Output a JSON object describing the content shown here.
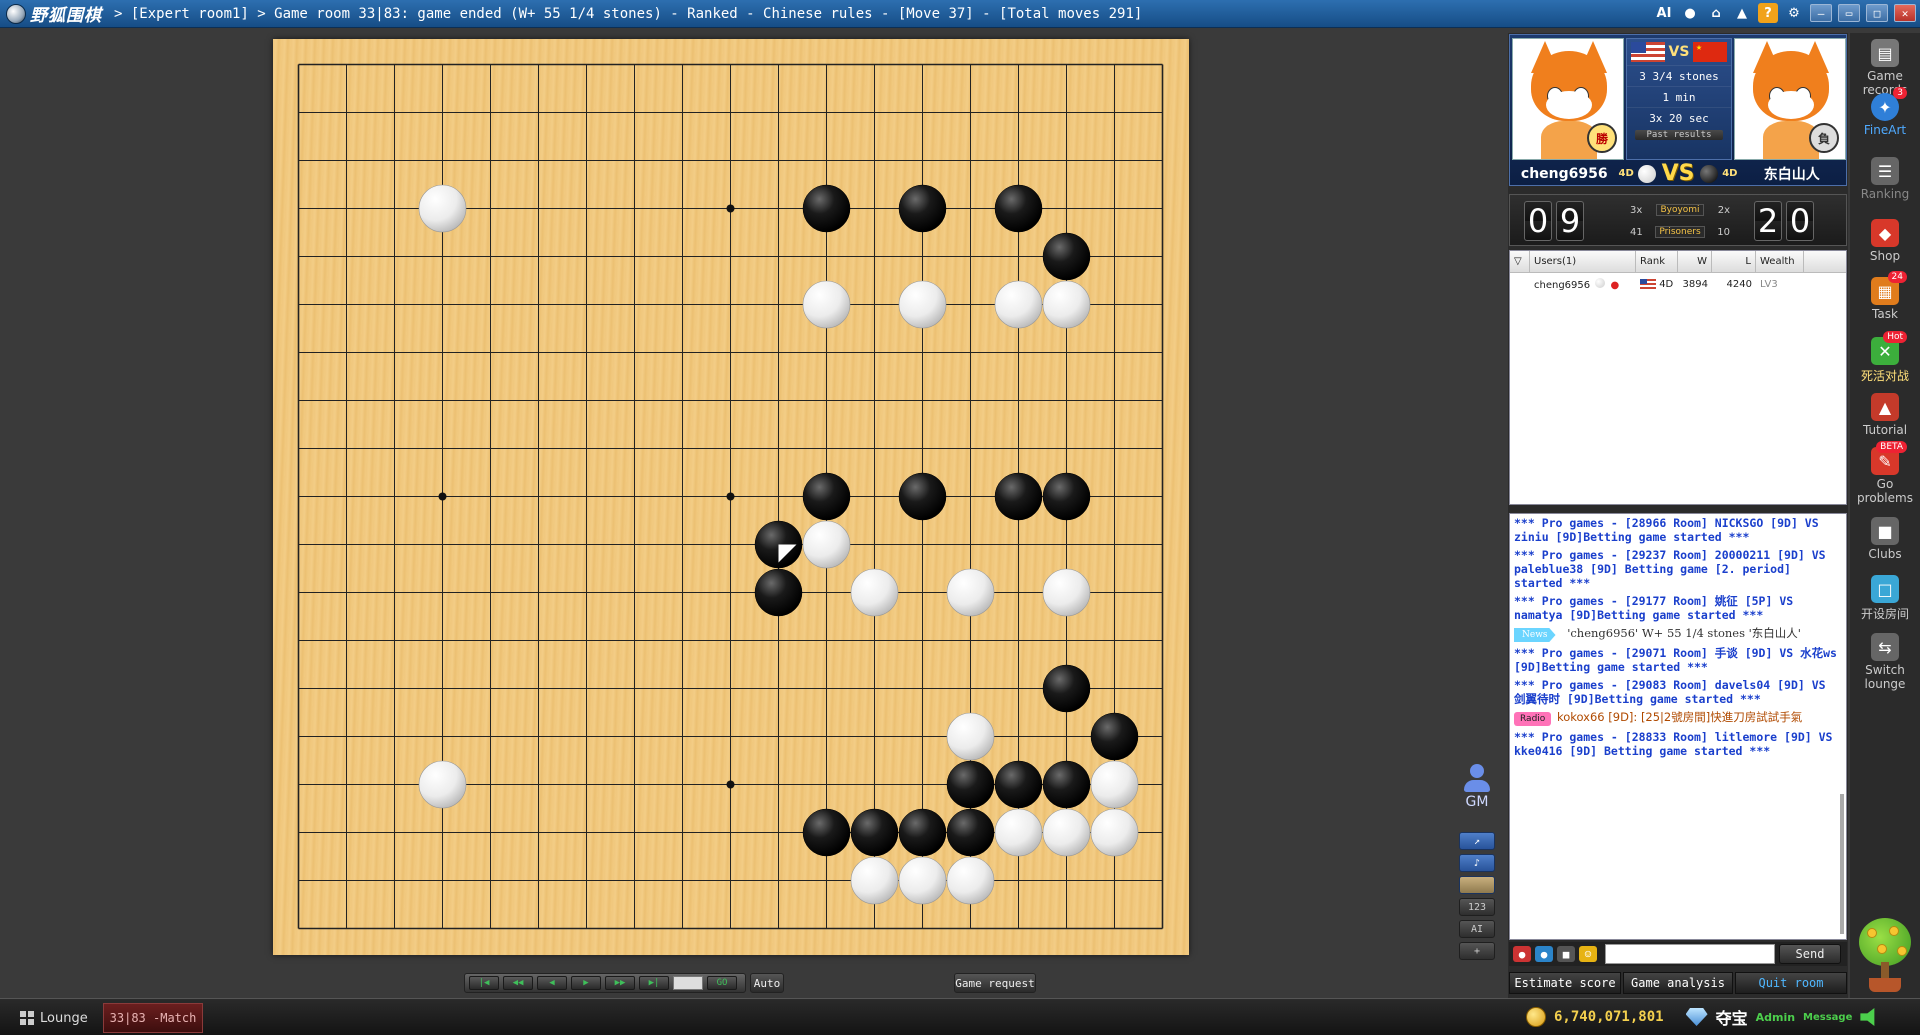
{
  "titlebar": {
    "app_name": "野狐围棋",
    "title": "> [Expert room1] > Game room 33|83: game ended (W+ 55 1/4 stones) - Ranked - Chinese rules - [Move 37] - [Total moves 291]",
    "icons": [
      "ai-icon",
      "user-icon",
      "home-icon",
      "shirt-icon",
      "help-icon",
      "settings-icon"
    ],
    "ai_label": "AI",
    "help_label": "?",
    "window_buttons": [
      "minimize",
      "restore",
      "maximize",
      "close"
    ]
  },
  "board": {
    "size": 19,
    "hoshi": [
      [
        3,
        3
      ],
      [
        3,
        9
      ],
      [
        3,
        15
      ],
      [
        9,
        3
      ],
      [
        9,
        9
      ],
      [
        9,
        15
      ],
      [
        15,
        3
      ],
      [
        15,
        9
      ],
      [
        15,
        15
      ]
    ],
    "black_stones": [
      [
        3,
        11
      ],
      [
        3,
        13
      ],
      [
        3,
        15
      ],
      [
        4,
        16
      ],
      [
        9,
        11
      ],
      [
        9,
        13
      ],
      [
        9,
        15
      ],
      [
        9,
        16
      ],
      [
        10,
        10
      ],
      [
        11,
        10
      ],
      [
        13,
        16
      ],
      [
        14,
        17
      ],
      [
        15,
        14
      ],
      [
        15,
        15
      ],
      [
        15,
        16
      ],
      [
        16,
        11
      ],
      [
        16,
        12
      ],
      [
        16,
        13
      ],
      [
        16,
        14
      ]
    ],
    "white_stones": [
      [
        3,
        3
      ],
      [
        5,
        11
      ],
      [
        5,
        13
      ],
      [
        5,
        15
      ],
      [
        5,
        16
      ],
      [
        10,
        11
      ],
      [
        11,
        12
      ],
      [
        11,
        14
      ],
      [
        11,
        16
      ],
      [
        14,
        14
      ],
      [
        15,
        3
      ],
      [
        15,
        17
      ],
      [
        16,
        15
      ],
      [
        16,
        16
      ],
      [
        16,
        17
      ],
      [
        17,
        12
      ],
      [
        17,
        13
      ],
      [
        17,
        14
      ]
    ],
    "last_move": [
      10,
      10
    ]
  },
  "controls": {
    "buttons": [
      "|◀",
      "◀◀",
      "◀",
      "▶",
      "▶▶",
      "▶|",
      "GO"
    ],
    "auto_label": "Auto",
    "game_request_label": "Game request"
  },
  "gm": {
    "label": "GM"
  },
  "side_tools": {
    "labels": [
      "↗",
      "♪",
      "",
      "123",
      "AI",
      "+"
    ]
  },
  "players": {
    "left": {
      "name": "cheng6956",
      "rank": "4D",
      "medal": "勝",
      "color": "white"
    },
    "right": {
      "name": "东白山人",
      "rank": "4D",
      "medal": "負",
      "color": "black"
    },
    "vs_label": "VS",
    "komi": "3 3/4 stones",
    "time_main": "1 min",
    "byoyomi": "3x 20 sec",
    "past_results": "Past results"
  },
  "score": {
    "left_digits": [
      "0",
      "9"
    ],
    "right_digits": [
      "2",
      "0"
    ],
    "byoyomi_label": "Byoyomi",
    "prisoners_label": "Prisoners",
    "left_byoyomi": "3x",
    "right_byoyomi": "2x",
    "left_prisoners": "41",
    "right_prisoners": "10"
  },
  "users": {
    "headers": [
      "Users(1)",
      "Rank",
      "W",
      "L",
      "Wealth"
    ],
    "rows": [
      {
        "name": "cheng6956",
        "rank": "4D",
        "w": "3894",
        "l": "4240",
        "wealth": "LV3"
      }
    ]
  },
  "chat": {
    "lines": [
      {
        "type": "pro",
        "text": "*** Pro games - [28966 Room] NICKSGO [9D] VS ziniu [9D]Betting game started ***"
      },
      {
        "type": "pro",
        "text": "*** Pro games - [29237 Room] 20000211 [9D] VS paleblue38 [9D] Betting game [2. period] started ***"
      },
      {
        "type": "pro",
        "text": "*** Pro games - [29177 Room] 姚征 [5P] VS namatya [9D]Betting game started ***"
      },
      {
        "type": "news",
        "tag": "News",
        "text": "'cheng6956' W+ 55 1/4 stones '东白山人'"
      },
      {
        "type": "pro",
        "text": "*** Pro games - [29071 Room] 手谈 [9D] VS 水花ws [9D]Betting game started ***"
      },
      {
        "type": "pro",
        "text": "*** Pro games - [29083 Room] davels04 [9D] VS 剑翼待时 [9D]Betting game started ***"
      },
      {
        "type": "radio",
        "tag": "Radio",
        "text": "kokox66 [9D]: [25|2號房間]快進刀房試試手氣"
      },
      {
        "type": "pro",
        "text": "*** Pro games - [28833 Room] litlemore [9D] VS kke0416 [9D] Betting game started ***"
      }
    ]
  },
  "chat_input": {
    "send_label": "Send"
  },
  "bottom_actions": {
    "estimate": "Estimate score",
    "analysis": "Game analysis",
    "quit": "Quit room"
  },
  "sidebar": {
    "items": [
      {
        "label": "Game records",
        "icon": "records-icon",
        "badge": ""
      },
      {
        "label": "FineArt",
        "icon": "fineart-icon",
        "badge": "3"
      },
      {
        "label": "Ranking",
        "icon": "ranking-icon",
        "badge": ""
      },
      {
        "label": "Shop",
        "icon": "shop-icon",
        "badge": ""
      },
      {
        "label": "Task",
        "icon": "task-icon",
        "badge": "24"
      },
      {
        "label": "死活对战",
        "icon": "life-death-icon",
        "badge": "Hot"
      },
      {
        "label": "Tutorial",
        "icon": "tutorial-icon",
        "badge": ""
      },
      {
        "label": "Go problems",
        "icon": "problems-icon",
        "badge": "BETA"
      },
      {
        "label": "Clubs",
        "icon": "clubs-icon",
        "badge": ""
      },
      {
        "label": "开设房间",
        "icon": "open-room-icon",
        "badge": ""
      },
      {
        "label": "Switch lounge",
        "icon": "switch-icon",
        "badge": ""
      }
    ]
  },
  "status": {
    "lounge_label": "Lounge",
    "match_tab": "33|83 -Match",
    "wealth": "6,740,071,801",
    "duobao": "夺宝",
    "admin": "Admin",
    "message": "Message"
  }
}
